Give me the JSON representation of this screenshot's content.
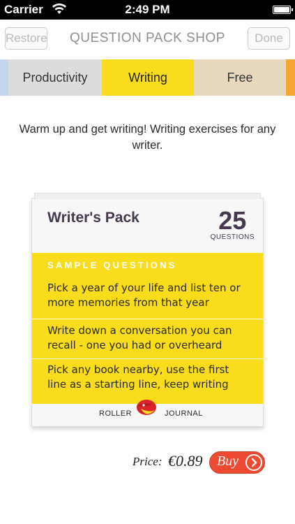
{
  "status_bar": {
    "carrier": "Carrier",
    "time": "2:49 PM",
    "wifi_icon": "wifi-icon",
    "battery_icon": "battery-icon"
  },
  "nav": {
    "restore_label": "Restore",
    "title": "QUESTION PACK SHOP",
    "done_label": "Done"
  },
  "tabs": [
    {
      "label": "Productivity",
      "color": "#dcdcdc"
    },
    {
      "label": "Writing",
      "color": "#f9dc1c",
      "selected": true
    },
    {
      "label": "Free",
      "color": "#e8d8be"
    }
  ],
  "tab_edges": {
    "left_color": "#c3d6ee",
    "right_color": "#f5a533"
  },
  "description": "Warm up and get writing! Writing exercises for any writer.",
  "pack": {
    "name": "Writer's Pack",
    "question_count": "25",
    "question_count_label": "QUESTIONS",
    "sample_header": "SAMPLE QUESTIONS",
    "samples": [
      "Pick a year of your life and list ten or more memories from that year",
      "Write down a conversation you can recall - one you had or overheard",
      "Pick any book nearby, use the first line as a starting line, keep writing"
    ],
    "brand_left": "ROLLER",
    "brand_right": "JOURNAL",
    "logo_icon": "roller-journal-logo",
    "accent_color": "#f9dc1c"
  },
  "purchase": {
    "price_label": "Price:",
    "price_value": "€0.89",
    "buy_label": "Buy",
    "buy_color": "#ee4a33"
  }
}
